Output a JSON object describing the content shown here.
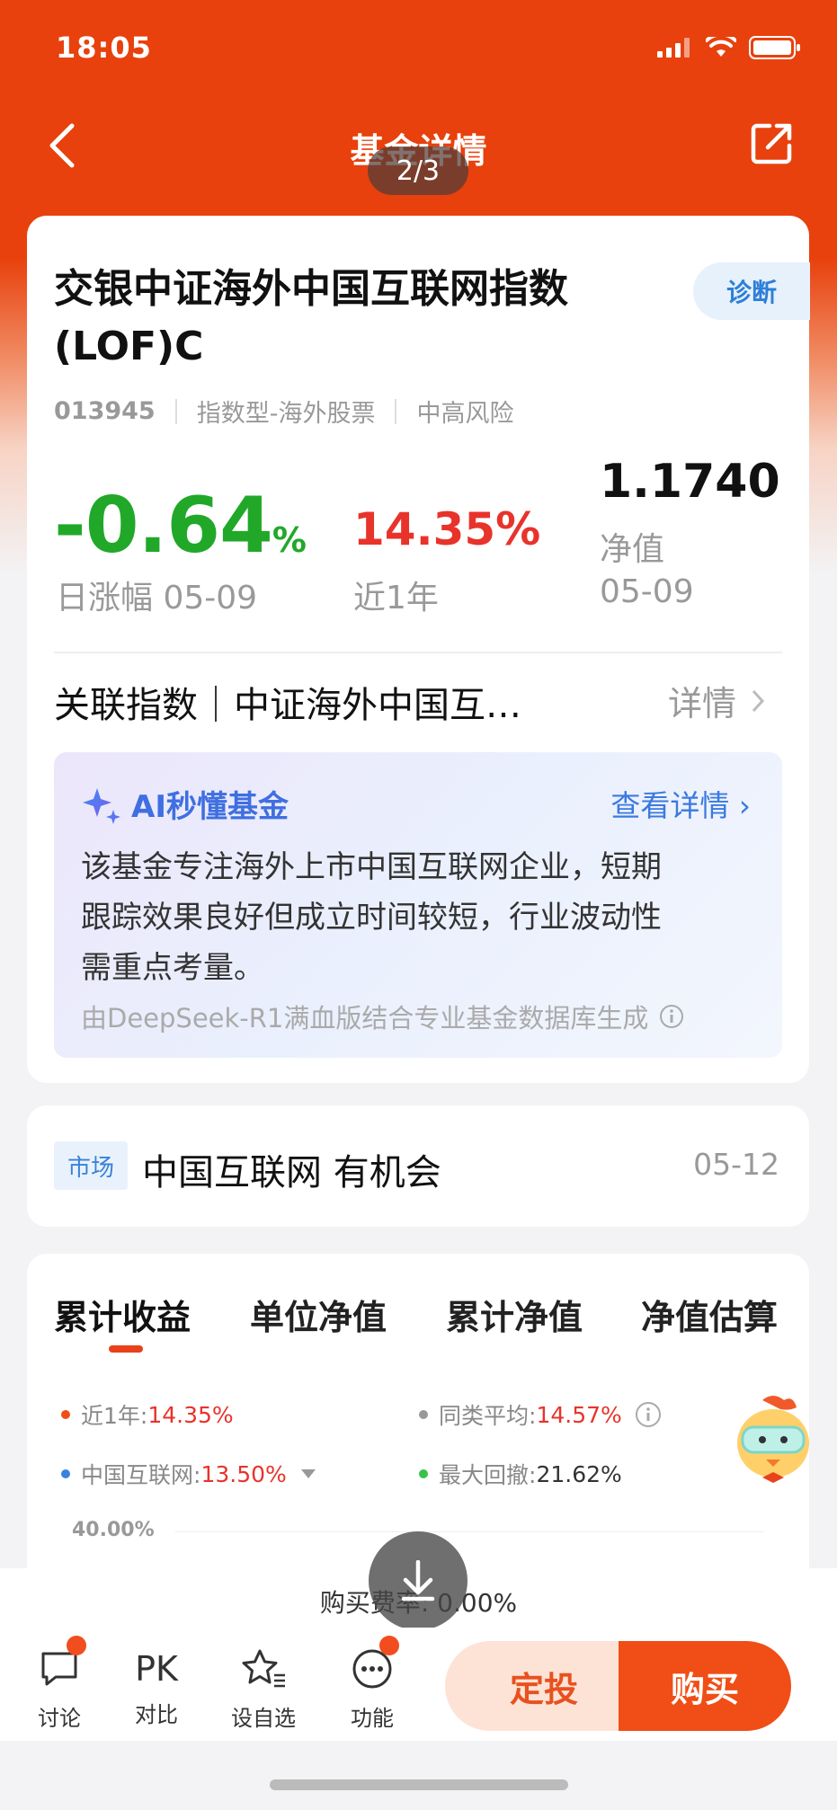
{
  "status": {
    "time": "18:05"
  },
  "nav": {
    "title": "基金详情",
    "page_indicator": "2/3"
  },
  "fund": {
    "name_line1": "交银中证海外中国互联网指数",
    "name_line2": "(LOF)C",
    "diagnose_label": "诊断",
    "code": "013945",
    "type": "指数型-海外股票",
    "risk": "中高风险",
    "daily_change_value": "-0.64",
    "daily_change_unit": "%",
    "daily_change_label": "日涨幅 05-09",
    "year_return": "14.35%",
    "year_return_label": "近1年",
    "nav_value": "1.1740",
    "nav_label": "净值",
    "nav_date": "05-09"
  },
  "assoc_index": {
    "label": "关联指数｜中证海外中国互…",
    "detail": "详情"
  },
  "ai": {
    "title": "AI秒懂基金",
    "more": "查看详情",
    "line1": "该基金专注海外上市中国互联网企业，短期",
    "line2": "跟踪效果良好但成立时间较短，行业波动性",
    "line3": "需重点考量。",
    "source": "由DeepSeek-R1满血版结合专业基金数据库生成"
  },
  "news": {
    "tag": "市场",
    "text": "中国互联网 有机会",
    "date": "05-12"
  },
  "tabs": [
    "累计收益",
    "单位净值",
    "累计净值",
    "净值估算"
  ],
  "legend": {
    "l1_key": "近1年:",
    "l1_val": "14.35%",
    "l2_key": "同类平均:",
    "l2_val": "14.57%",
    "l3_key": "中国互联网:",
    "l3_val": "13.50%",
    "l4_key": "最大回撤:",
    "l4_val": "21.62%"
  },
  "chart": {
    "ytick_top": "40.00%"
  },
  "fee": {
    "text": "购买费率: 0.00%"
  },
  "bottom": {
    "discuss": "讨论",
    "compare_icon": "PK",
    "compare": "对比",
    "watchlist": "设自选",
    "functions": "功能",
    "auto_invest": "定投",
    "buy": "购买"
  },
  "colors": {
    "brand": "#e8410d",
    "up": "#e8332b",
    "down": "#21a829",
    "link": "#3a7ae0"
  }
}
